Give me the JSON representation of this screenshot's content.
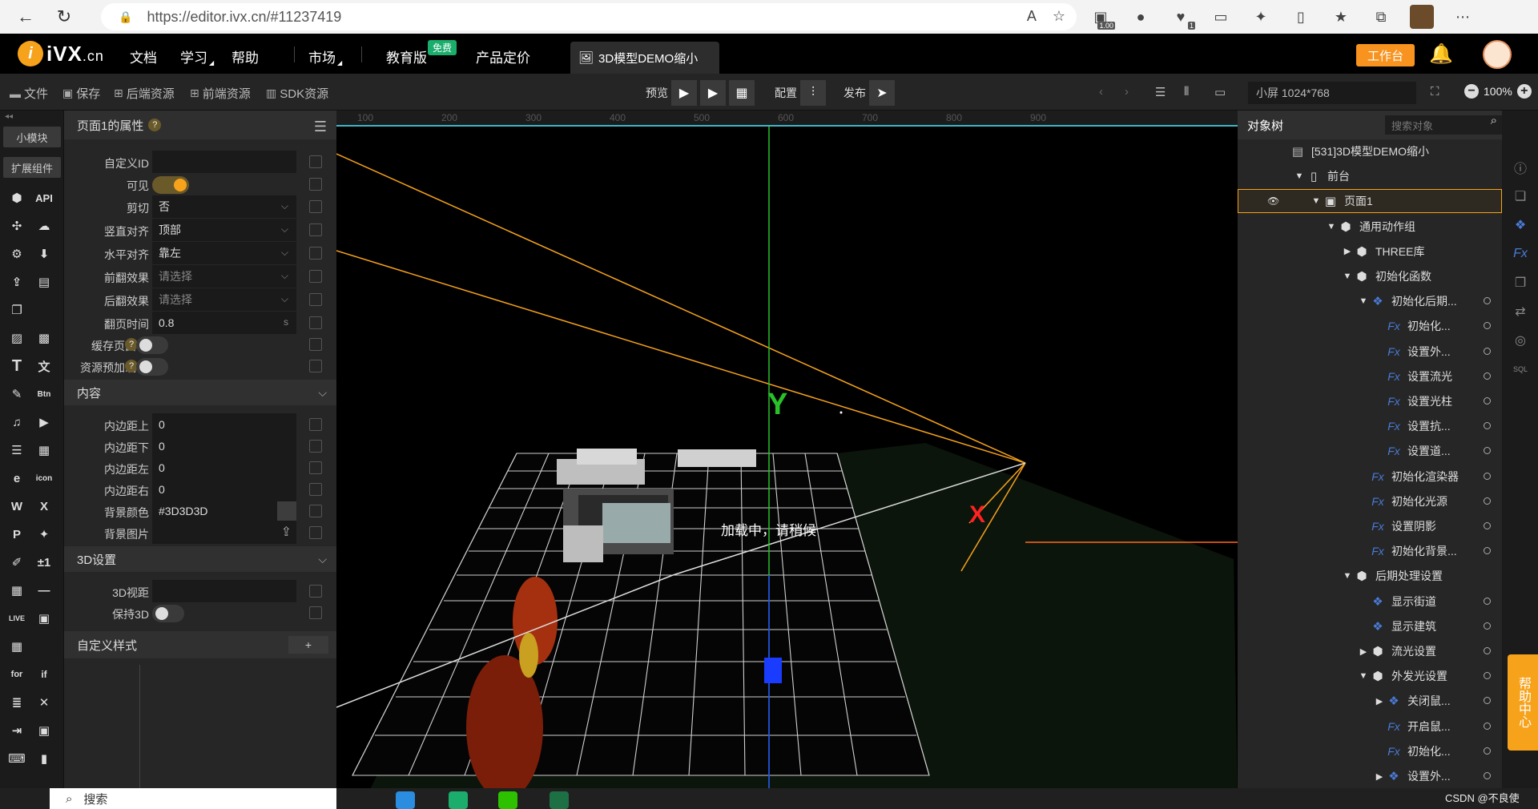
{
  "browser": {
    "url": "https://editor.ivx.cn/#11237419",
    "ext_badge_1": "1.00",
    "ext_badge_2": "1"
  },
  "app": {
    "logo_text": "iVX",
    "logo_suffix": ".cn",
    "nav": [
      {
        "label": "文档"
      },
      {
        "label": "学习"
      },
      {
        "label": "帮助"
      },
      {
        "label": "市场"
      },
      {
        "label": "教育版"
      },
      {
        "label": "产品定价"
      }
    ],
    "free_badge": "免费",
    "doc_tab": "3D模型DEMO缩小",
    "workbench": "工作台"
  },
  "toolbar": {
    "file": "文件",
    "save": "保存",
    "backend": "后端资源",
    "frontend": "前端资源",
    "sdk": "SDK资源",
    "preview": "预览",
    "config": "配置",
    "publish": "发布",
    "screen": "小屏 1024*768",
    "zoom": "100%"
  },
  "leftstrip": {
    "tab1": "小模块",
    "tab2": "扩展组件",
    "api": "API"
  },
  "props": {
    "title": "页面1的属性",
    "help": "?",
    "rows": [
      {
        "label": "自定义ID",
        "value": ""
      },
      {
        "label": "可见",
        "value": ""
      },
      {
        "label": "剪切",
        "value": "否"
      },
      {
        "label": "竖直对齐",
        "value": "顶部"
      },
      {
        "label": "水平对齐",
        "value": "靠左"
      },
      {
        "label": "前翻效果",
        "value": "请选择"
      },
      {
        "label": "后翻效果",
        "value": "请选择"
      },
      {
        "label": "翻页时间",
        "value": "0.8",
        "unit": "s"
      },
      {
        "label": "缓存页面",
        "value": ""
      },
      {
        "label": "资源预加载",
        "value": ""
      }
    ],
    "section_content": "内容",
    "content_rows": [
      {
        "label": "内边距上",
        "value": "0"
      },
      {
        "label": "内边距下",
        "value": "0"
      },
      {
        "label": "内边距左",
        "value": "0"
      },
      {
        "label": "内边距右",
        "value": "0"
      },
      {
        "label": "背景颜色",
        "value": "#3D3D3D"
      },
      {
        "label": "背景图片",
        "value": ""
      }
    ],
    "section_3d": "3D设置",
    "rows_3d": [
      {
        "label": "3D视距",
        "value": ""
      },
      {
        "label": "保持3D",
        "value": ""
      }
    ],
    "section_custom": "自定义样式",
    "add": "+"
  },
  "canvas": {
    "ruler": [
      "100",
      "200",
      "300",
      "400",
      "500",
      "600",
      "700",
      "800",
      "900"
    ],
    "loading": "加载中，请稍候",
    "axis_y": "Y",
    "axis_x": "X"
  },
  "tree": {
    "tab": "对象树",
    "search_placeholder": "搜索对象",
    "items": [
      {
        "label": "[531]3D模型DEMO缩小",
        "indent": 0,
        "arrow": "",
        "icon": "folder-icon"
      },
      {
        "label": "前台",
        "indent": 1,
        "arrow": "▼",
        "icon": "phone-icon"
      },
      {
        "label": "页面1",
        "indent": 2,
        "arrow": "▼",
        "icon": "page-icon",
        "selected": true
      },
      {
        "label": "通用动作组",
        "indent": 3,
        "arrow": "▼",
        "icon": "cube-icon"
      },
      {
        "label": "THREE库",
        "indent": 4,
        "arrow": "▶",
        "icon": "cube-icon"
      },
      {
        "label": "初始化函数",
        "indent": 4,
        "arrow": "▼",
        "icon": "cube-icon"
      },
      {
        "label": "初始化后期...",
        "indent": 5,
        "arrow": "▼",
        "icon": "action-icon"
      },
      {
        "label": "初始化...",
        "indent": 6,
        "arrow": "",
        "icon": "fx-icon"
      },
      {
        "label": "设置外...",
        "indent": 6,
        "arrow": "",
        "icon": "fx-icon"
      },
      {
        "label": "设置流光",
        "indent": 6,
        "arrow": "",
        "icon": "fx-icon"
      },
      {
        "label": "设置光柱",
        "indent": 6,
        "arrow": "",
        "icon": "fx-icon"
      },
      {
        "label": "设置抗...",
        "indent": 6,
        "arrow": "",
        "icon": "fx-icon"
      },
      {
        "label": "设置道...",
        "indent": 6,
        "arrow": "",
        "icon": "fx-icon"
      },
      {
        "label": "初始化渲染器",
        "indent": 5,
        "arrow": "",
        "icon": "fx-icon"
      },
      {
        "label": "初始化光源",
        "indent": 5,
        "arrow": "",
        "icon": "fx-icon"
      },
      {
        "label": "设置阴影",
        "indent": 5,
        "arrow": "",
        "icon": "fx-icon"
      },
      {
        "label": "初始化背景...",
        "indent": 5,
        "arrow": "",
        "icon": "fx-icon"
      },
      {
        "label": "后期处理设置",
        "indent": 4,
        "arrow": "▼",
        "icon": "cube-icon"
      },
      {
        "label": "显示街道",
        "indent": 5,
        "arrow": "",
        "icon": "action-icon"
      },
      {
        "label": "显示建筑",
        "indent": 5,
        "arrow": "",
        "icon": "action-icon"
      },
      {
        "label": "流光设置",
        "indent": 5,
        "arrow": "▶",
        "icon": "cube-icon"
      },
      {
        "label": "外发光设置",
        "indent": 5,
        "arrow": "▼",
        "icon": "cube-icon"
      },
      {
        "label": "关闭鼠...",
        "indent": 6,
        "arrow": "▶",
        "icon": "action-icon"
      },
      {
        "label": "开启鼠...",
        "indent": 6,
        "arrow": "",
        "icon": "fx-icon"
      },
      {
        "label": "初始化...",
        "indent": 6,
        "arrow": "",
        "icon": "fx-icon"
      },
      {
        "label": "设置外...",
        "indent": 6,
        "arrow": "▶",
        "icon": "action-icon"
      }
    ]
  },
  "help_tab": "帮助中心",
  "taskbar": {
    "search": "搜索",
    "watermark": "CSDN @不良使"
  },
  "colors": {
    "accent": "#f7a21b",
    "free": "#1aad6b",
    "fx": "#4a7bd8"
  }
}
